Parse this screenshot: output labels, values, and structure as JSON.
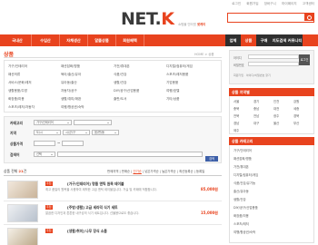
{
  "topbar": {
    "links": [
      "로그인",
      "회원가입",
      "장바구니",
      "마이페이지",
      "고객센터"
    ]
  },
  "header": {
    "logo_main": "NET.",
    "logo_accent": "K",
    "tagline_pre": "쇼핑몰 인터넷",
    "tagline_brand": "넷케이",
    "search_placeholder": ""
  },
  "nav": {
    "left": [
      "국내산",
      "수입산",
      "자체생산",
      "알뜰상품",
      "회원혜택"
    ],
    "right": [
      "업체",
      "상품",
      "구매",
      "지도검색",
      "커뮤니티"
    ]
  },
  "page": {
    "title": "상품",
    "breadcrumb": "HOME > 상품"
  },
  "categories": [
    [
      "가구/인테리어",
      "패션잡화/명품",
      "가전/휴대폰",
      "디지털/컴퓨터/게임"
    ],
    [
      "패션의류",
      "육아/출산/유아",
      "식품/건강",
      "스포츠/레저용품"
    ],
    [
      "서비스/문화/레저",
      "유아동/출산",
      "생활/건강",
      "기업용품"
    ],
    [
      "생활용품/주방",
      "자동차/공구",
      "DIY/공구/산업용품",
      "여행/호텔"
    ],
    [
      "화장품/미용",
      "생활/취미/애완",
      "출판/도서",
      "기타/상품"
    ],
    [
      "스포츠/레저/자동차",
      "여행/항공권/숙박",
      "",
      ""
    ]
  ],
  "filters": {
    "category_label": "카테고리",
    "category_sel1": "가구/인테리어",
    "category_sel2": "",
    "region_label": "지역",
    "region_sel1": "도/시",
    "region_sel2": "시/군/구",
    "region_sel3": "읍/면/동",
    "price_label": "상품가격",
    "price_sep": "~",
    "keyword_label": "검색어",
    "keyword_sel": "선택",
    "search_button": "검색"
  },
  "results": {
    "count_pre": "상품 전체",
    "count": "21",
    "count_post": "건",
    "sort": [
      "판매지역",
      "판매순",
      "인기순",
      "낮은가격순",
      "높은가격순",
      "최신등록순",
      "등록일"
    ],
    "items": [
      {
        "badge": "추천",
        "title": "[가구/인테리어] 명품 앤틱 원목 테이블",
        "desc": "최고 품질의 원목을 사용하여 제작한 고급 앤틱 테이블입니다. 거실 및 카페에 적합합니다.",
        "price": "85,000원"
      },
      {
        "badge": "추천",
        "title": "[주방/생활] 고급 세라믹 식기 세트",
        "desc": "깔끔한 디자인과 튼튼한 내구성의 식기 세트입니다. 선물용으로도 좋습니다.",
        "price": "15,000원"
      },
      {
        "badge": "추천",
        "title": "[생활/취미] 나무 장식 소품",
        "desc": "",
        "price": ""
      }
    ]
  },
  "sidebar": {
    "login": {
      "id_label": "아이디",
      "pw_label": "비밀번호",
      "button": "로그인",
      "links": "회원가입 · 아이디/비밀번호 찾기"
    },
    "region_head": "상품 지역별",
    "regions": [
      [
        "서울",
        "경기",
        "인천",
        "강원"
      ],
      [
        "충북",
        "충남",
        "대전",
        "세종"
      ],
      [
        "전북",
        "전남",
        "광주",
        "경북"
      ],
      [
        "경남",
        "대구",
        "울산",
        "부산"
      ],
      [
        "제주",
        "",
        "",
        ""
      ]
    ],
    "cat_head": "상품 카테고리",
    "cats": [
      "가구/인테리어",
      "패션잡화/명품",
      "가전/휴대폰",
      "디지털/컴퓨터/게임",
      "식품/건강/유기농",
      "출산/유아동",
      "생활/건강",
      "DIY/공구/산업용품",
      "화장품/미용",
      "스포츠/레저",
      "여행/항공권/숙박"
    ]
  },
  "colors": {
    "accent": "#e8431e",
    "nav_dark": "#2f2f2f",
    "button_blue": "#3d5fa8"
  }
}
